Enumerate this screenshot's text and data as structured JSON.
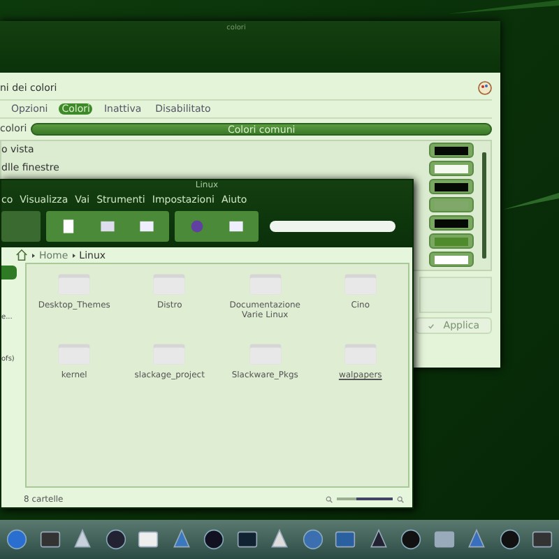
{
  "colors_window": {
    "title": "colori",
    "heading": "ni dei colori",
    "tabs": [
      {
        "label": "Opzioni",
        "selected": false
      },
      {
        "label": "Colori",
        "selected": true
      },
      {
        "label": "Inattiva",
        "selected": false
      },
      {
        "label": "Disabilitato",
        "selected": false
      }
    ],
    "scheme_label": "colori",
    "scheme_value": "Colori comuni",
    "items": [
      {
        "label": "o vista"
      },
      {
        "label": "dlle finestre"
      }
    ],
    "swatches": [
      {
        "color": "#050a05"
      },
      {
        "color": "#f4faee"
      },
      {
        "color": "#050a05"
      },
      {
        "color": "#7fa86a"
      },
      {
        "color": "#050a05"
      },
      {
        "color": "#4f8a2c"
      },
      {
        "color": "#ffffff"
      }
    ],
    "apply_button": "Applica"
  },
  "file_manager": {
    "title": "Linux",
    "menu": [
      "co",
      "Visualizza",
      "Vai",
      "Strumenti",
      "Impostazioni",
      "Aiuto"
    ],
    "breadcrumb": [
      "Home",
      "Linux"
    ],
    "sidebar_texts": [
      "e...",
      "ofs)"
    ],
    "folders": [
      {
        "name": "Desktop_Themes",
        "hovered": false
      },
      {
        "name": "Distro",
        "hovered": false
      },
      {
        "name": "Documentazione Varie Linux",
        "hovered": false
      },
      {
        "name": "Cino",
        "hovered": false
      },
      {
        "name": "kernel",
        "hovered": false
      },
      {
        "name": "slackage_project",
        "hovered": false
      },
      {
        "name": "Slackware_Pkgs",
        "hovered": false
      },
      {
        "name": "walpapers",
        "hovered": true
      }
    ],
    "status": "8 cartelle",
    "zoom": {
      "level": 0.35
    }
  }
}
